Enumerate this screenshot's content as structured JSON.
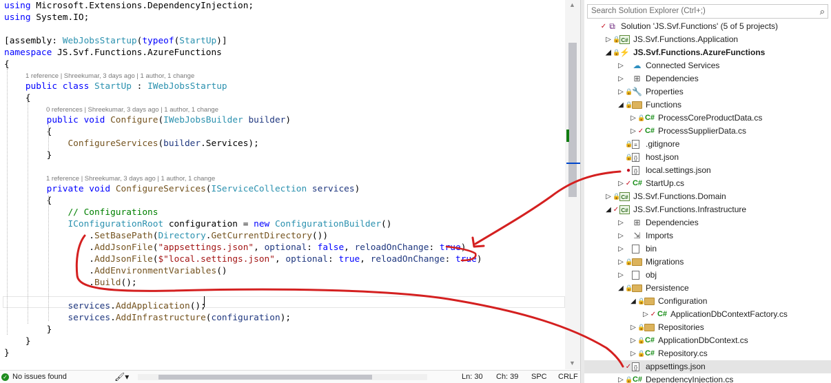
{
  "editor": {
    "lines": [
      {
        "tokens": [
          {
            "t": "using ",
            "c": "kw"
          },
          {
            "t": "Microsoft.Extensions.DependencyInjection;"
          }
        ]
      },
      {
        "tokens": [
          {
            "t": "using ",
            "c": "kw"
          },
          {
            "t": "System.IO;"
          }
        ]
      },
      {
        "tokens": []
      },
      {
        "tokens": [
          {
            "t": "[assembly: "
          },
          {
            "t": "WebJobsStartup",
            "c": "ty"
          },
          {
            "t": "("
          },
          {
            "t": "typeof",
            "c": "kw"
          },
          {
            "t": "("
          },
          {
            "t": "StartUp",
            "c": "ty"
          },
          {
            "t": ")]"
          }
        ]
      },
      {
        "tokens": [
          {
            "t": "namespace ",
            "c": "kw"
          },
          {
            "t": "JS.Svf.Functions.AzureFunctions"
          }
        ]
      },
      {
        "tokens": [
          {
            "t": "{"
          }
        ]
      },
      {
        "lens": "1 reference | Shreekumar, 3 days ago | 1 author, 1 change"
      },
      {
        "tokens": [
          {
            "t": "    "
          },
          {
            "t": "public class ",
            "c": "kw"
          },
          {
            "t": "StartUp",
            "c": "ty"
          },
          {
            "t": " : "
          },
          {
            "t": "IWebJobsStartup",
            "c": "ty"
          }
        ]
      },
      {
        "tokens": [
          {
            "t": "    {"
          }
        ]
      },
      {
        "lens": "0 references | Shreekumar, 3 days ago | 1 author, 1 change"
      },
      {
        "tokens": [
          {
            "t": "        "
          },
          {
            "t": "public void ",
            "c": "kw"
          },
          {
            "t": "Configure",
            "c": "mt"
          },
          {
            "t": "("
          },
          {
            "t": "IWebJobsBuilder",
            "c": "ty"
          },
          {
            "t": " "
          },
          {
            "t": "builder",
            "c": "pm"
          },
          {
            "t": ")"
          }
        ]
      },
      {
        "tokens": [
          {
            "t": "        {"
          }
        ]
      },
      {
        "tokens": [
          {
            "t": "            "
          },
          {
            "t": "ConfigureServices",
            "c": "mt"
          },
          {
            "t": "("
          },
          {
            "t": "builder",
            "c": "pm"
          },
          {
            "t": ".Services);"
          }
        ]
      },
      {
        "tokens": [
          {
            "t": "        }"
          }
        ]
      },
      {
        "tokens": []
      },
      {
        "lens": "1 reference | Shreekumar, 3 days ago | 1 author, 1 change"
      },
      {
        "tokens": [
          {
            "t": "        "
          },
          {
            "t": "private void ",
            "c": "kw"
          },
          {
            "t": "ConfigureServices",
            "c": "mt"
          },
          {
            "t": "("
          },
          {
            "t": "IServiceCollection",
            "c": "ty"
          },
          {
            "t": " "
          },
          {
            "t": "services",
            "c": "pm"
          },
          {
            "t": ")"
          }
        ]
      },
      {
        "tokens": [
          {
            "t": "        {"
          }
        ]
      },
      {
        "tokens": [
          {
            "t": "            "
          },
          {
            "t": "// Configurations",
            "c": "cm"
          }
        ]
      },
      {
        "tokens": [
          {
            "t": "            "
          },
          {
            "t": "IConfigurationRoot",
            "c": "ty"
          },
          {
            "t": " configuration = "
          },
          {
            "t": "new ",
            "c": "kw"
          },
          {
            "t": "ConfigurationBuilder",
            "c": "ty"
          },
          {
            "t": "()"
          }
        ]
      },
      {
        "tokens": [
          {
            "t": "                ."
          },
          {
            "t": "SetBasePath",
            "c": "mt"
          },
          {
            "t": "("
          },
          {
            "t": "Directory",
            "c": "ty"
          },
          {
            "t": "."
          },
          {
            "t": "GetCurrentDirectory",
            "c": "mt"
          },
          {
            "t": "())"
          }
        ]
      },
      {
        "tokens": [
          {
            "t": "                ."
          },
          {
            "t": "AddJsonFile",
            "c": "mt"
          },
          {
            "t": "("
          },
          {
            "t": "\"appsettings.json\"",
            "c": "st"
          },
          {
            "t": ", "
          },
          {
            "t": "optional",
            "c": "pm"
          },
          {
            "t": ": "
          },
          {
            "t": "false",
            "c": "kw"
          },
          {
            "t": ", "
          },
          {
            "t": "reloadOnChange",
            "c": "pm"
          },
          {
            "t": ": "
          },
          {
            "t": "true",
            "c": "kw"
          },
          {
            "t": ")"
          }
        ]
      },
      {
        "tokens": [
          {
            "t": "                ."
          },
          {
            "t": "AddJsonFile",
            "c": "mt"
          },
          {
            "t": "("
          },
          {
            "t": "$\"local.settings.json\"",
            "c": "st"
          },
          {
            "t": ", "
          },
          {
            "t": "optional",
            "c": "pm"
          },
          {
            "t": ": "
          },
          {
            "t": "true",
            "c": "kw"
          },
          {
            "t": ", "
          },
          {
            "t": "reloadOnChange",
            "c": "pm"
          },
          {
            "t": ": "
          },
          {
            "t": "true",
            "c": "kw"
          },
          {
            "t": ")"
          }
        ]
      },
      {
        "tokens": [
          {
            "t": "                ."
          },
          {
            "t": "AddEnvironmentVariables",
            "c": "mt"
          },
          {
            "t": "()"
          }
        ]
      },
      {
        "tokens": [
          {
            "t": "                ."
          },
          {
            "t": "Build",
            "c": "mt"
          },
          {
            "t": "();"
          }
        ]
      },
      {
        "tokens": []
      },
      {
        "tokens": [
          {
            "t": "            "
          },
          {
            "t": "services",
            "c": "pm"
          },
          {
            "t": "."
          },
          {
            "t": "AddApplication",
            "c": "mt"
          },
          {
            "t": "();"
          }
        ]
      },
      {
        "tokens": [
          {
            "t": "            "
          },
          {
            "t": "services",
            "c": "pm"
          },
          {
            "t": "."
          },
          {
            "t": "AddInfrastructure",
            "c": "mt"
          },
          {
            "t": "("
          },
          {
            "t": "configuration",
            "c": "pm"
          },
          {
            "t": ");"
          }
        ]
      },
      {
        "tokens": [
          {
            "t": "        }"
          }
        ]
      },
      {
        "tokens": [
          {
            "t": "    }"
          }
        ]
      },
      {
        "tokens": [
          {
            "t": "}"
          }
        ]
      }
    ]
  },
  "status": {
    "issues": "No issues found",
    "position": "Ln: 30",
    "column": "Ch: 39",
    "insert_mode": "SPC",
    "line_ending": "CRLF"
  },
  "solution_explorer": {
    "search_placeholder": "Search Solution Explorer (Ctrl+;)",
    "items": [
      {
        "label": "Solution 'JS.Svf.Functions' (5 of 5 projects)",
        "icon": "solution-icon",
        "chev": "",
        "mark": "check"
      },
      {
        "label": "JS.Svf.Functions.Application",
        "icon": "csharp-project-icon",
        "chev": "right",
        "mark": "lock"
      },
      {
        "label": "JS.Svf.Functions.AzureFunctions",
        "icon": "azure-functions-project-icon",
        "chev": "down",
        "mark": "lock",
        "bold": true
      },
      {
        "label": "Connected Services",
        "icon": "connected-services-icon",
        "chev": "right",
        "mark": ""
      },
      {
        "label": "Dependencies",
        "icon": "dependencies-icon",
        "chev": "right",
        "mark": ""
      },
      {
        "label": "Properties",
        "icon": "properties-icon",
        "chev": "right",
        "mark": "lock"
      },
      {
        "label": "Functions",
        "icon": "folder-icon",
        "chev": "down",
        "mark": "lock"
      },
      {
        "label": "ProcessCoreProductData.cs",
        "icon": "csharp-file-icon",
        "chev": "right",
        "mark": "lock"
      },
      {
        "label": "ProcessSupplierData.cs",
        "icon": "csharp-file-icon",
        "chev": "right",
        "mark": "check"
      },
      {
        "label": ".gitignore",
        "icon": "text-file-icon",
        "chev": "",
        "mark": "lock"
      },
      {
        "label": "host.json",
        "icon": "json-file-icon",
        "chev": "",
        "mark": "lock"
      },
      {
        "label": "local.settings.json",
        "icon": "json-file-icon",
        "chev": "",
        "mark": "dot"
      },
      {
        "label": "StartUp.cs",
        "icon": "csharp-file-icon",
        "chev": "right",
        "mark": "check"
      },
      {
        "label": "JS.Svf.Functions.Domain",
        "icon": "csharp-project-icon",
        "chev": "right",
        "mark": "lock"
      },
      {
        "label": "JS.Svf.Functions.Infrastructure",
        "icon": "csharp-project-icon",
        "chev": "down",
        "mark": "check"
      },
      {
        "label": "Dependencies",
        "icon": "dependencies-icon",
        "chev": "right",
        "mark": ""
      },
      {
        "label": "Imports",
        "icon": "imports-icon",
        "chev": "right",
        "mark": ""
      },
      {
        "label": "bin",
        "icon": "hidden-folder-icon",
        "chev": "right",
        "mark": ""
      },
      {
        "label": "Migrations",
        "icon": "folder-icon",
        "chev": "right",
        "mark": "lock"
      },
      {
        "label": "obj",
        "icon": "hidden-folder-icon",
        "chev": "right",
        "mark": ""
      },
      {
        "label": "Persistence",
        "icon": "folder-icon",
        "chev": "down",
        "mark": "lock"
      },
      {
        "label": "Configuration",
        "icon": "folder-icon",
        "chev": "down",
        "mark": "lock"
      },
      {
        "label": "ApplicationDbContextFactory.cs",
        "icon": "csharp-file-icon",
        "chev": "right",
        "mark": "check"
      },
      {
        "label": "Repositories",
        "icon": "folder-icon",
        "chev": "right",
        "mark": "lock"
      },
      {
        "label": "ApplicationDbContext.cs",
        "icon": "csharp-file-icon",
        "chev": "right",
        "mark": "lock"
      },
      {
        "label": "Repository.cs",
        "icon": "csharp-file-icon",
        "chev": "right",
        "mark": "lock"
      },
      {
        "label": "appsettings.json",
        "icon": "json-file-icon",
        "chev": "",
        "mark": "check",
        "selected": true
      },
      {
        "label": "DependencyInjection.cs",
        "icon": "csharp-file-icon",
        "chev": "right",
        "mark": "lock"
      }
    ]
  },
  "colors": {
    "keyword": "#0000ff",
    "type": "#2b91af",
    "string": "#a31515",
    "comment": "#008000",
    "parameter": "#1f377f",
    "method": "#74531f",
    "annotation": "#d42020"
  }
}
